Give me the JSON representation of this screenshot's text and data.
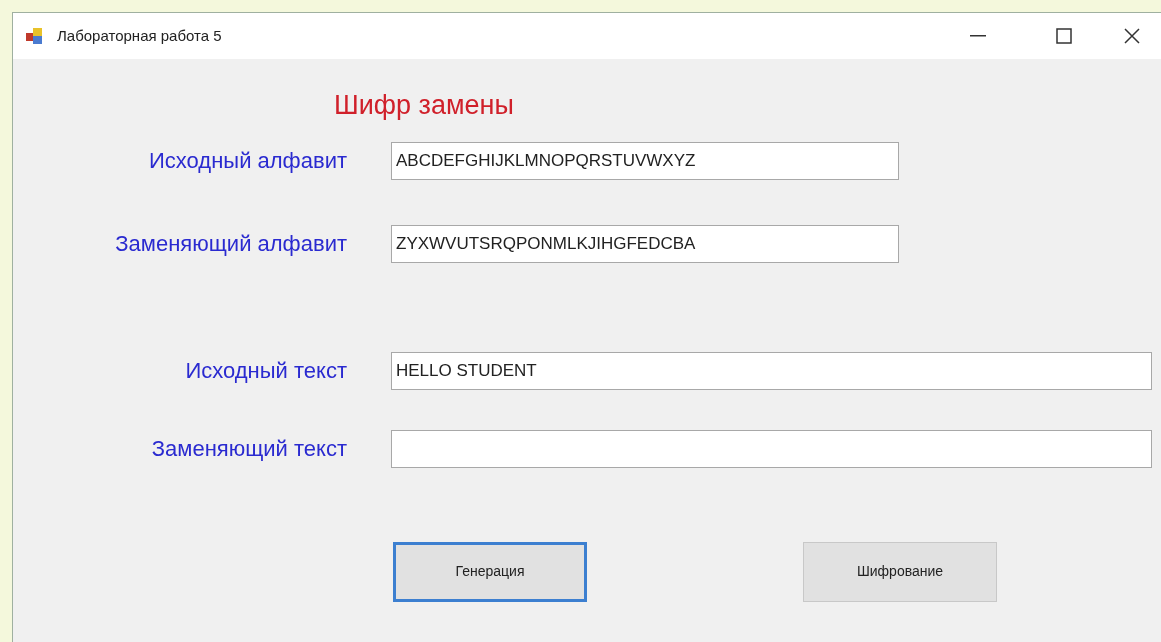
{
  "window": {
    "title": "Лабораторная работа 5"
  },
  "heading": "Шифр замены",
  "fields": [
    {
      "label": "Исходный алфавит",
      "value": "ABCDEFGHIJKLMNOPQRSTUVWXYZ",
      "wide": false
    },
    {
      "label": "Заменяющий алфавит",
      "value": "ZYXWVUTSRQPONMLKJIHGFEDCBA",
      "wide": false
    },
    {
      "label": "Исходный текст",
      "value": "HELLO STUDENT",
      "wide": true
    },
    {
      "label": "Заменяющий текст",
      "wide": true
    }
  ],
  "buttons": [
    {
      "label": "Генерация",
      "focused": true
    },
    {
      "label": "Шифрование",
      "focused": false
    }
  ]
}
